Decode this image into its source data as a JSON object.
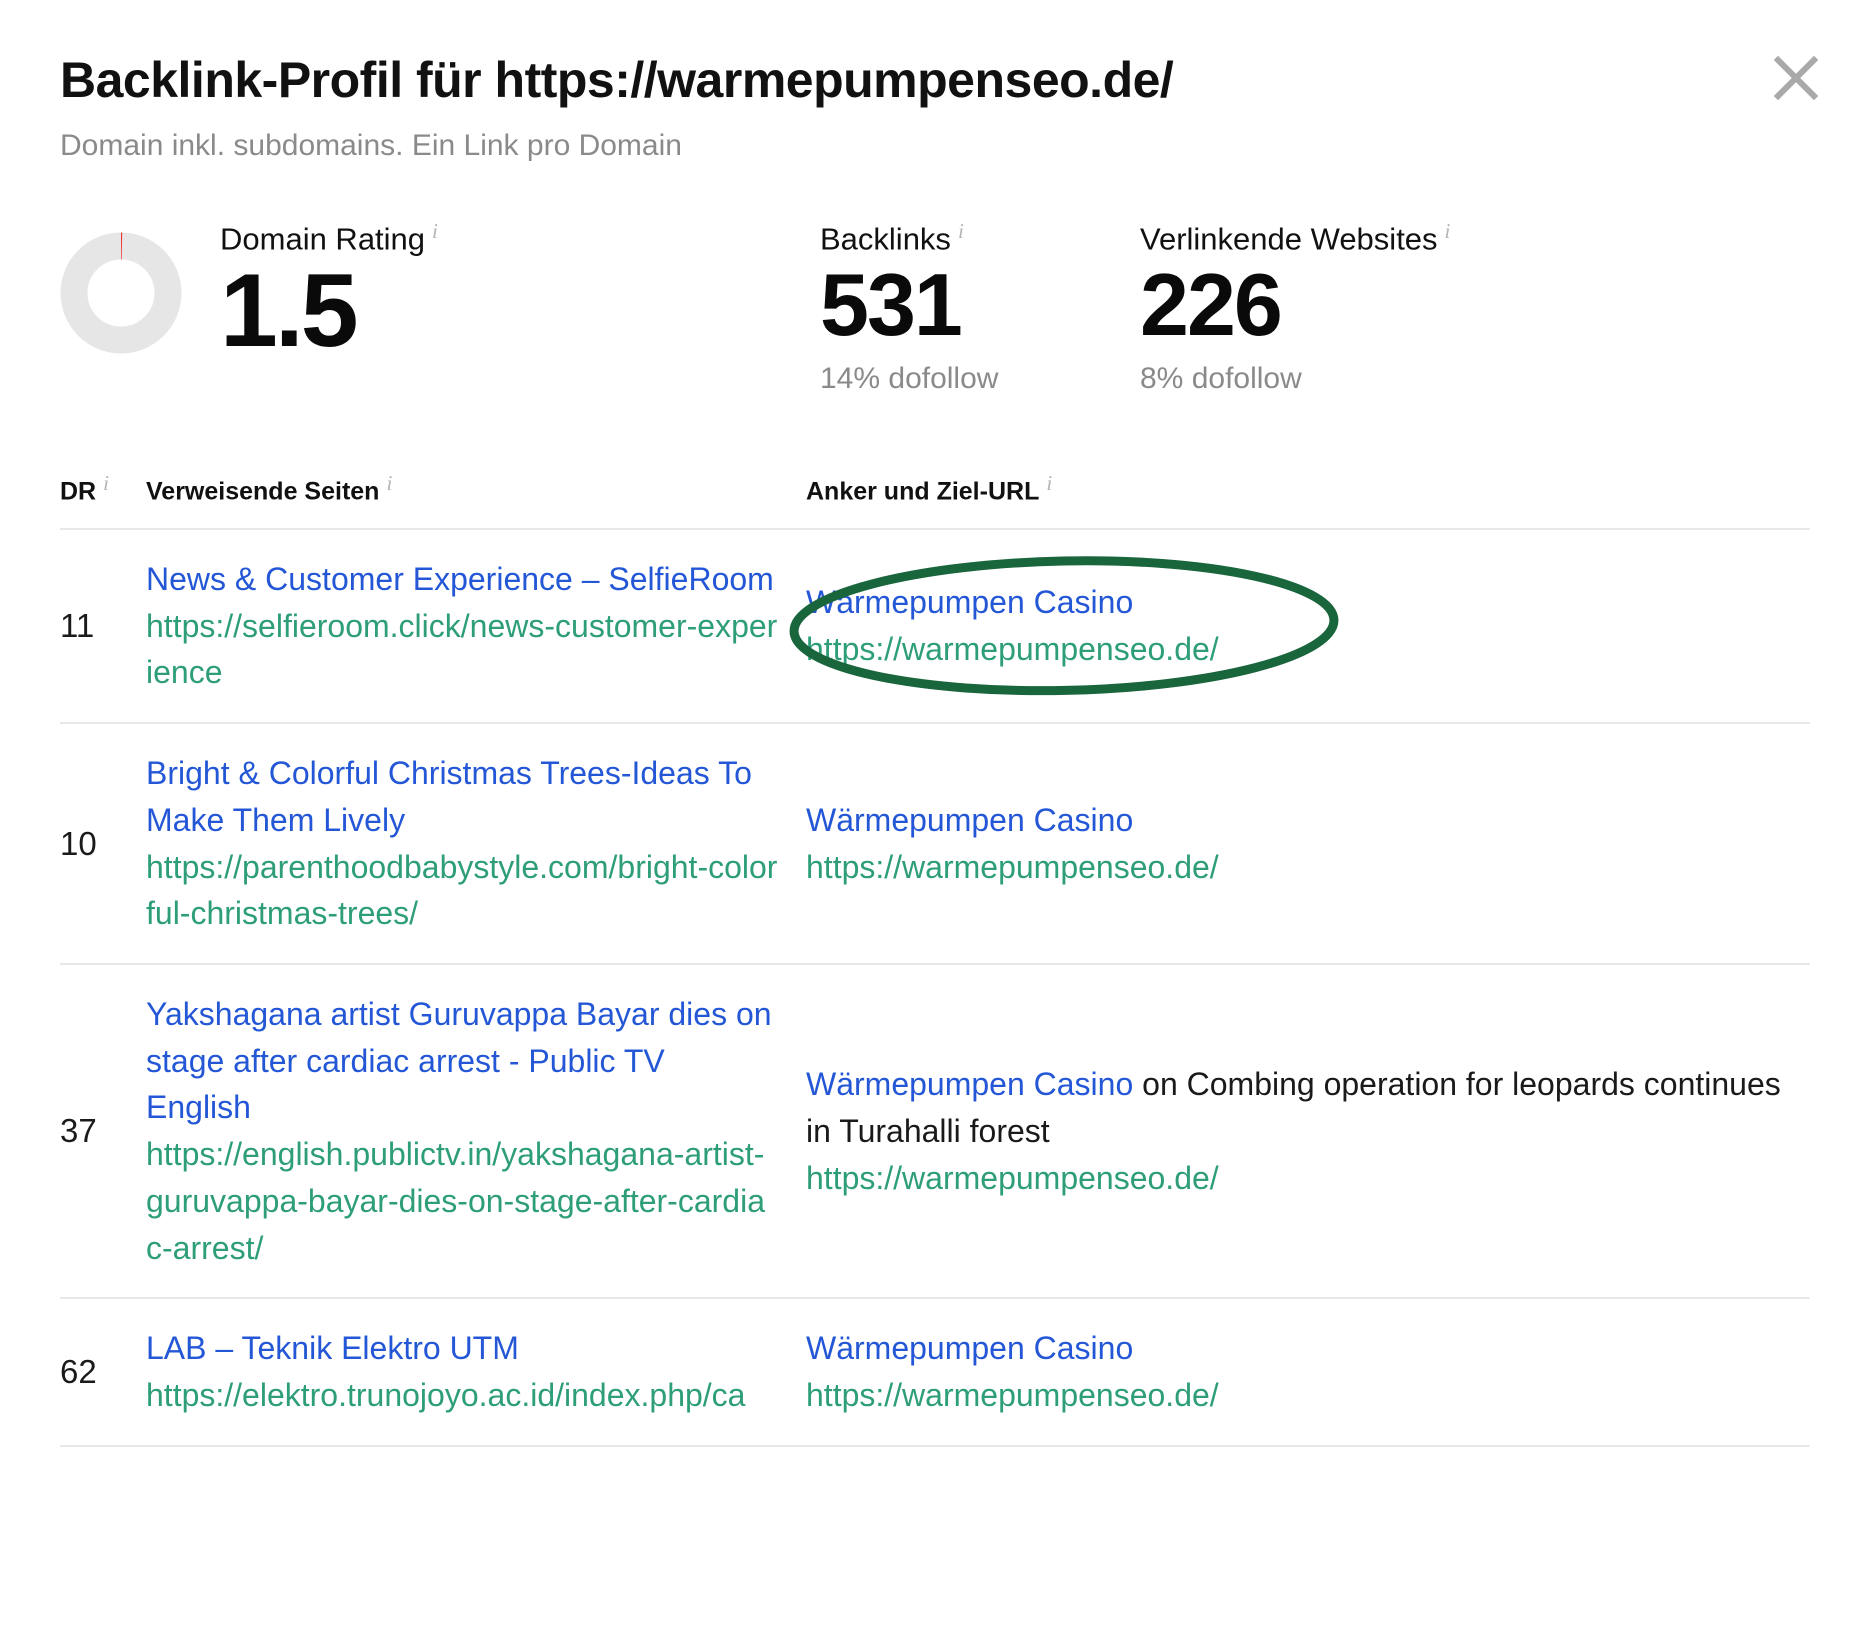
{
  "header": {
    "title": "Backlink-Profil für https://warmepumpenseo.de/",
    "subtitle": "Domain inkl. subdomains. Ein Link pro Domain",
    "close_icon": "close-icon"
  },
  "metrics": {
    "domain_rating": {
      "label": "Domain Rating",
      "value": "1.5",
      "info": "i",
      "gauge_color": "#f0302e",
      "gauge_track": "#e6e6e6"
    },
    "backlinks": {
      "label": "Backlinks",
      "value": "531",
      "sub": "14% dofollow",
      "info": "i"
    },
    "referring_websites": {
      "label": "Verlinkende Websites",
      "value": "226",
      "sub": "8% dofollow",
      "info": "i"
    }
  },
  "table": {
    "headers": {
      "dr": "DR",
      "referring_pages": "Verweisende Seiten",
      "anchor_target": "Anker und Ziel-URL",
      "info": "i"
    },
    "rows": [
      {
        "dr": "11",
        "page_title": "News & Customer Experience – SelfieRoom",
        "page_url": "https://selfieroom.click/news-customer-experience",
        "anchor_text": "Wärmepumpen Casino",
        "anchor_suffix": "",
        "target_url": "https://warmepumpenseo.de/",
        "highlighted": true
      },
      {
        "dr": "10",
        "page_title": "Bright & Colorful Christmas Trees-Ideas To Make Them Lively",
        "page_url": "https://parenthoodbabystyle.com/bright-colorful-christmas-trees/",
        "anchor_text": "Wärmepumpen Casino",
        "anchor_suffix": "",
        "target_url": "https://warmepumpenseo.de/",
        "highlighted": false
      },
      {
        "dr": "37",
        "page_title": "Yakshagana artist Guruvappa Bayar dies on stage after cardiac arrest - Public TV English",
        "page_url": "https://english.publictv.in/yakshagana-artist-guruvappa-bayar-dies-on-stage-after-cardiac-arrest/",
        "anchor_text": "Wärmepumpen Casino",
        "anchor_suffix": " on Combing operation for leopards continues in Turahalli forest",
        "target_url": "https://warmepumpenseo.de/",
        "highlighted": false
      },
      {
        "dr": "62",
        "page_title": "LAB – Teknik Elektro UTM",
        "page_url": "https://elektro.trunojoyo.ac.id/index.php/ca",
        "anchor_text": "Wärmepumpen Casino",
        "anchor_suffix": "",
        "target_url": "https://warmepumpenseo.de/",
        "highlighted": false
      }
    ]
  },
  "annotation": {
    "shape": "ellipse",
    "color": "#19653c",
    "stroke_width": 9,
    "targets": "row-1 anchor and target url"
  },
  "colors": {
    "link_blue": "#2457d6",
    "url_green": "#2e9e79",
    "annotation_green": "#19653c",
    "muted_gray": "#8a8a8a",
    "divider": "#e8e8e8"
  }
}
